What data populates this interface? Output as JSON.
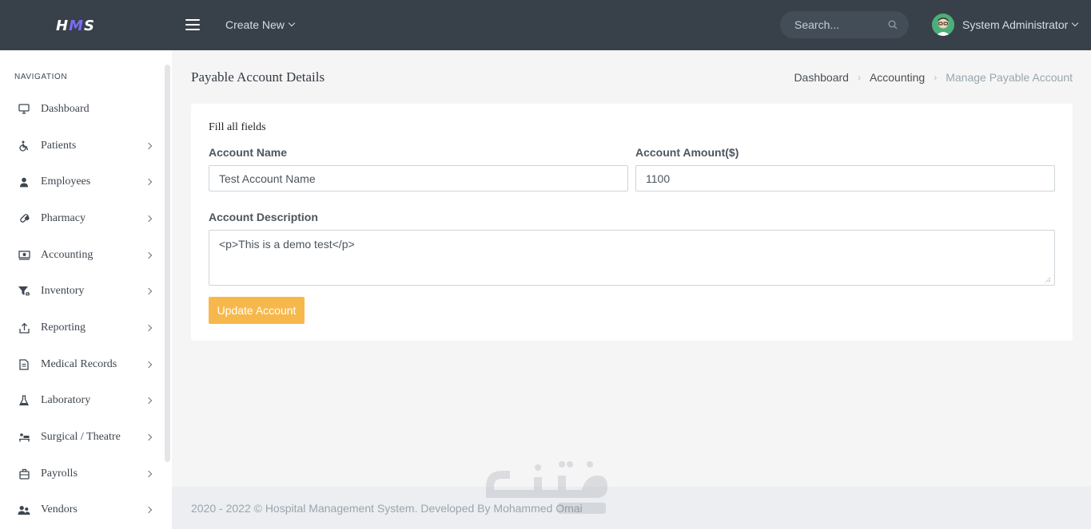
{
  "topbar": {
    "logo": {
      "left": "H",
      "mid": "M",
      "right": "S"
    },
    "create_new": "Create New",
    "search_placeholder": "Search...",
    "user_name": "System Administrator"
  },
  "sidebar": {
    "title": "NAVIGATION",
    "items": [
      {
        "label": "Dashboard",
        "icon": "monitor-icon",
        "has_arrow": false
      },
      {
        "label": "Patients",
        "icon": "wheelchair-icon",
        "has_arrow": true
      },
      {
        "label": "Employees",
        "icon": "user-icon",
        "has_arrow": true
      },
      {
        "label": "Pharmacy",
        "icon": "pill-icon",
        "has_arrow": true
      },
      {
        "label": "Accounting",
        "icon": "money-icon",
        "has_arrow": true
      },
      {
        "label": "Inventory",
        "icon": "filter-icon",
        "has_arrow": true
      },
      {
        "label": "Reporting",
        "icon": "upload-icon",
        "has_arrow": true
      },
      {
        "label": "Medical Records",
        "icon": "file-icon",
        "has_arrow": true
      },
      {
        "label": "Laboratory",
        "icon": "flask-icon",
        "has_arrow": true
      },
      {
        "label": "Surgical / Theatre",
        "icon": "bed-icon",
        "has_arrow": true
      },
      {
        "label": "Payrolls",
        "icon": "briefcase-icon",
        "has_arrow": true
      },
      {
        "label": "Vendors",
        "icon": "users-icon",
        "has_arrow": true
      }
    ]
  },
  "page": {
    "title": "Payable Account Details",
    "breadcrumb": [
      "Dashboard",
      "Accounting",
      "Manage Payable Account"
    ]
  },
  "form": {
    "subtitle": "Fill all fields",
    "account_name_label": "Account Name",
    "account_name_value": "Test Account Name",
    "account_amount_label": "Account Amount($)",
    "account_amount_value": "1100",
    "account_description_label": "Account Description",
    "account_description_value": "<p>This is a demo test</p>",
    "submit_label": "Update Account"
  },
  "footer": {
    "text": "2020 - 2022 © Hospital Management System. Developed By Mohammed Omai"
  },
  "colors": {
    "topbar": "#38414a",
    "accent_button": "#f7b84b",
    "logo_mid": "#7b6cf6"
  }
}
